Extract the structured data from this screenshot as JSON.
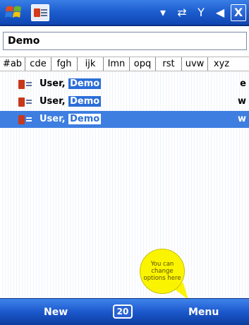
{
  "titlebar": {
    "start_icon": "windows-start-icon",
    "app_icon": "contacts-icon",
    "status_icons": [
      "signal-dropdown-icon",
      "sync-arrows-icon",
      "antenna-icon",
      "speaker-icon"
    ],
    "close_label": "X"
  },
  "search": {
    "value": "Demo",
    "placeholder": ""
  },
  "alphabet": [
    "#ab",
    "cde",
    "fgh",
    "ijk",
    "lmn",
    "opq",
    "rst",
    "uvw",
    "xyz"
  ],
  "contacts": [
    {
      "last": "User,",
      "first": "Demo",
      "tag": "e",
      "selected": false
    },
    {
      "last": "User,",
      "first": "Demo",
      "tag": "w",
      "selected": false
    },
    {
      "last": "User,",
      "first": "Demo",
      "tag": "w",
      "selected": true
    }
  ],
  "bubble": {
    "text": "You can change options here"
  },
  "softbar": {
    "left_label": "New",
    "center_label": "20",
    "right_label": "Menu"
  },
  "colors": {
    "titlebar": "#1e5fd0",
    "selection": "#3d7ee0",
    "bubble": "#fbf400"
  }
}
